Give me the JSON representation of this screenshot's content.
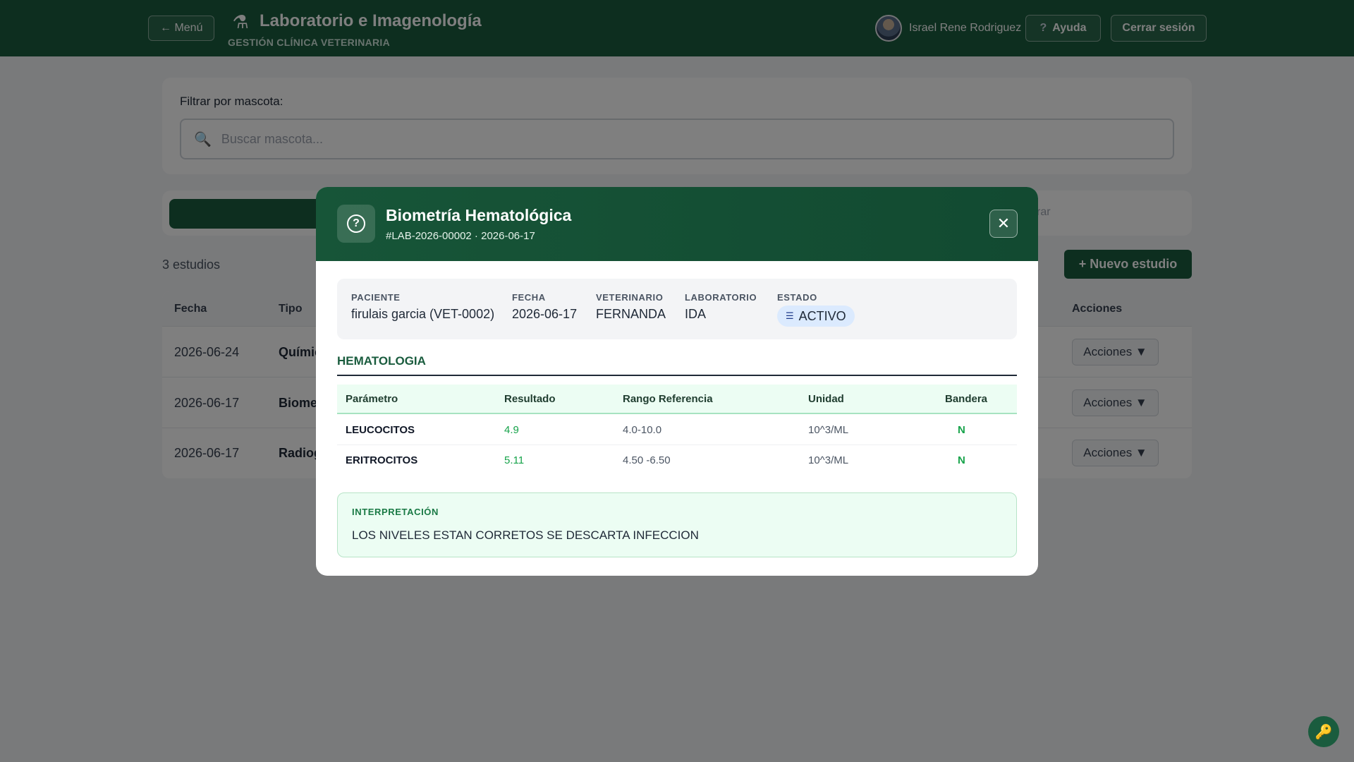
{
  "header": {
    "menu_label": "← Menú",
    "brand_icon": "microscope-icon",
    "title": "Laboratorio e Imagenología",
    "subtitle": "GESTIÓN CLÍNICA VETERINARIA",
    "user_name": "Israel Rene Rodriguez",
    "help_label": "Ayuda",
    "logout_label": "Cerrar sesión"
  },
  "filter": {
    "label": "Filtrar por mascota:",
    "placeholder": "Buscar mascota..."
  },
  "toolbar": {
    "clear_label": "rar"
  },
  "list": {
    "count_label": "3 estudios",
    "new_button": "+ Nuevo estudio",
    "columns": {
      "date": "Fecha",
      "type": "Tipo",
      "actions": "Acciones"
    },
    "rows": [
      {
        "date": "2026-06-24",
        "type": "Químic",
        "action": "Acciones ▼"
      },
      {
        "date": "2026-06-17",
        "type": "Biome",
        "action": "Acciones ▼"
      },
      {
        "date": "2026-06-17",
        "type": "Radiog",
        "action": "Acciones ▼"
      }
    ]
  },
  "modal": {
    "icon": "help-circle-icon",
    "title": "Biometría Hematológica",
    "subtitle": "#LAB-2026-00002 · 2026-06-17",
    "close": "✕",
    "info": {
      "patient_label": "PACIENTE",
      "patient_value": "firulais garcia (VET-0002)",
      "date_label": "FECHA",
      "date_value": "2026-06-17",
      "vet_label": "VETERINARIO",
      "vet_value": "FERNANDA",
      "lab_label": "LABORATORIO",
      "lab_value": "IDA",
      "status_label": "ESTADO",
      "status_value": "ACTIVO"
    },
    "section_title": "HEMATOLOGIA",
    "columns": {
      "param": "Parámetro",
      "result": "Resultado",
      "range": "Rango Referencia",
      "unit": "Unidad",
      "flag": "Bandera"
    },
    "rows": [
      {
        "param": "LEUCOCITOS",
        "result": "4.9",
        "range": "4.0-10.0",
        "unit": "10^3/ML",
        "flag": "N"
      },
      {
        "param": "ERITROCITOS",
        "result": "5.11",
        "range": "4.50 -6.50",
        "unit": "10^3/ML",
        "flag": "N"
      }
    ],
    "interpretation_label": "INTERPRETACIÓN",
    "interpretation_text": "LOS NIVELES ESTAN CORRETOS SE DESCARTA INFECCION"
  },
  "fab_icon": "key-icon",
  "colors": {
    "primary": "#1a5c3e",
    "success": "#16a34a",
    "badge": "#dbeafe"
  }
}
